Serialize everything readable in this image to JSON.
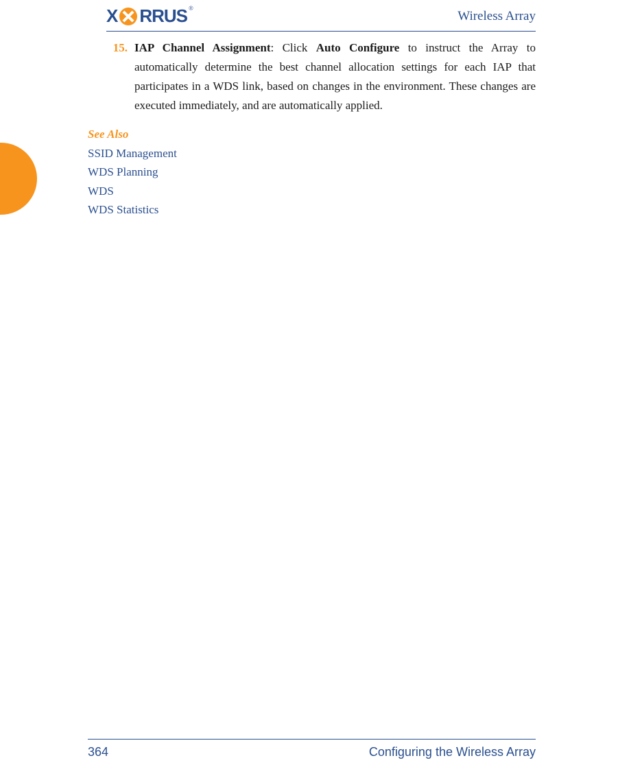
{
  "header": {
    "logo_prefix": "X",
    "logo_suffix": "RRUS",
    "logo_reg": "®",
    "title_right": "Wireless Array"
  },
  "body": {
    "item_number": "15.",
    "item_title": "IAP Channel Assignment",
    "item_sep": ": Click ",
    "item_bold2": "Auto Configure",
    "item_rest": " to instruct the Array to automatically determine the best channel allocation settings for each IAP that participates in a WDS link, based on changes in the environment. These changes are executed immediately, and are automatically applied."
  },
  "see_also": {
    "heading": "See Also",
    "links": [
      "SSID Management",
      "WDS Planning",
      "WDS",
      "WDS Statistics"
    ]
  },
  "footer": {
    "page_number": "364",
    "section_title": "Configuring the Wireless Array"
  },
  "colors": {
    "accent_orange": "#f7941e",
    "brand_blue": "#2a4f8f"
  }
}
